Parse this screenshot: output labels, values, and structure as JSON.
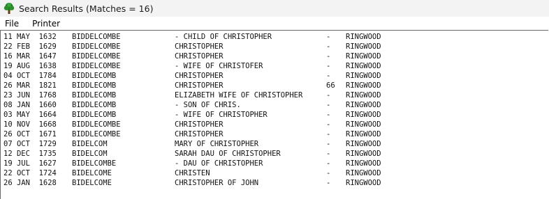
{
  "window": {
    "title": "Search Results (Matches = 16)",
    "icon": "tree-icon"
  },
  "menu": {
    "file": "File",
    "printer": "Printer"
  },
  "results": [
    {
      "date": "11 MAY  1632",
      "surname": "BIDDELCOMBE",
      "description": "- CHILD OF CHRISTOPHER",
      "age": "-",
      "place": "RINGWOOD"
    },
    {
      "date": "22 FEB  1629",
      "surname": "BIDDELCOMBE",
      "description": "CHRISTOPHER",
      "age": "-",
      "place": "RINGWOOD"
    },
    {
      "date": "16 MAR  1647",
      "surname": "BIDDELCOMBE",
      "description": "CHRISTOPHER",
      "age": "-",
      "place": "RINGWOOD"
    },
    {
      "date": "19 AUG  1638",
      "surname": "BIDDELCOMBE",
      "description": "- WIFE OF CHRISTOFER",
      "age": "-",
      "place": "RINGWOOD"
    },
    {
      "date": "04 OCT  1784",
      "surname": "BIDDLECOMB",
      "description": "CHRISTOPHER",
      "age": "-",
      "place": "RINGWOOD"
    },
    {
      "date": "26 MAR  1821",
      "surname": "BIDDLECOMB",
      "description": "CHRISTOPHER",
      "age": "66",
      "place": "RINGWOOD"
    },
    {
      "date": "23 JUN  1768",
      "surname": "BIDDLECOMB",
      "description": "ELIZABETH WIFE OF CHRISTOPHER",
      "age": "-",
      "place": "RINGWOOD"
    },
    {
      "date": "08 JAN  1660",
      "surname": "BIDDLECOMB",
      "description": "- SON OF CHRIS.",
      "age": "-",
      "place": "RINGWOOD"
    },
    {
      "date": "03 MAY  1664",
      "surname": "BIDDLECOMB",
      "description": "- WIFE OF CHRISTOPHER",
      "age": "-",
      "place": "RINGWOOD"
    },
    {
      "date": "10 NOV  1668",
      "surname": "BIDDLECOMBE",
      "description": "CHRISTOPHER",
      "age": "-",
      "place": "RINGWOOD"
    },
    {
      "date": "26 OCT  1671",
      "surname": "BIDDLECOMBE",
      "description": "CHRISTOPHER",
      "age": "-",
      "place": "RINGWOOD"
    },
    {
      "date": "07 OCT  1729",
      "surname": "BIDELCOM",
      "description": "MARY OF CHRISTOPHER",
      "age": "-",
      "place": "RINGWOOD"
    },
    {
      "date": "12 DEC  1735",
      "surname": "BIDELCOM",
      "description": "SARAH DAU OF CHRISTOPHER",
      "age": "-",
      "place": "RINGWOOD"
    },
    {
      "date": "19 JUL  1627",
      "surname": "BIDELCOMBE",
      "description": "- DAU OF CHRISTOPHER",
      "age": "-",
      "place": "RINGWOOD"
    },
    {
      "date": "22 OCT  1724",
      "surname": "BIDELCOME",
      "description": "CHRISTEN",
      "age": "-",
      "place": "RINGWOOD"
    },
    {
      "date": "26 JAN  1628",
      "surname": "BIDELCOME",
      "description": "CHRISTOPHER OF JOHN",
      "age": "-",
      "place": "RINGWOOD"
    }
  ]
}
